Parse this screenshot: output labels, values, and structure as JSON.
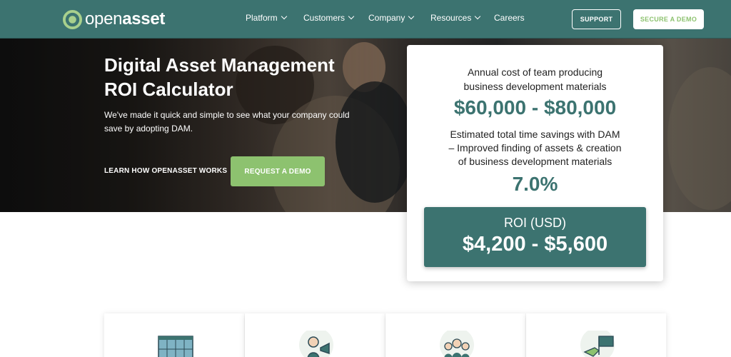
{
  "brand": {
    "logo_text_light": "open",
    "logo_text_bold": "asset"
  },
  "nav": {
    "items": [
      {
        "label": "Platform",
        "dropdown": true
      },
      {
        "label": "Customers",
        "dropdown": true
      },
      {
        "label": "Company",
        "dropdown": true
      },
      {
        "label": "Resources",
        "dropdown": true
      },
      {
        "label": "Careers",
        "dropdown": false
      }
    ],
    "support_label": "SUPPORT",
    "demo_label": "SECURE A DEMO"
  },
  "hero": {
    "title": "Digital Asset Management ROI Calculator",
    "subtitle": "We've made it quick and simple to see what your company could save by adopting DAM.",
    "link_label": "LEARN HOW OPENASSET WORKS",
    "button_label": "REQUEST A DEMO"
  },
  "calculator": {
    "cost_label_1": "Annual cost of team producing",
    "cost_label_2": "business development materials",
    "cost_value": "$60,000 - $80,000",
    "savings_label_1": "Estimated total time savings with DAM",
    "savings_label_2": "– Improved finding of assets & creation",
    "savings_label_3": "of business development materials",
    "savings_value": "7.0%",
    "roi_label": "ROI (USD)",
    "roi_value": "$4,200 - $5,600"
  },
  "feature_icons": [
    "building-icon",
    "person-megaphone-icon",
    "team-icon",
    "flag-hand-icon"
  ],
  "colors": {
    "brand_teal": "#3c7370",
    "accent_green": "#8dc26f"
  }
}
